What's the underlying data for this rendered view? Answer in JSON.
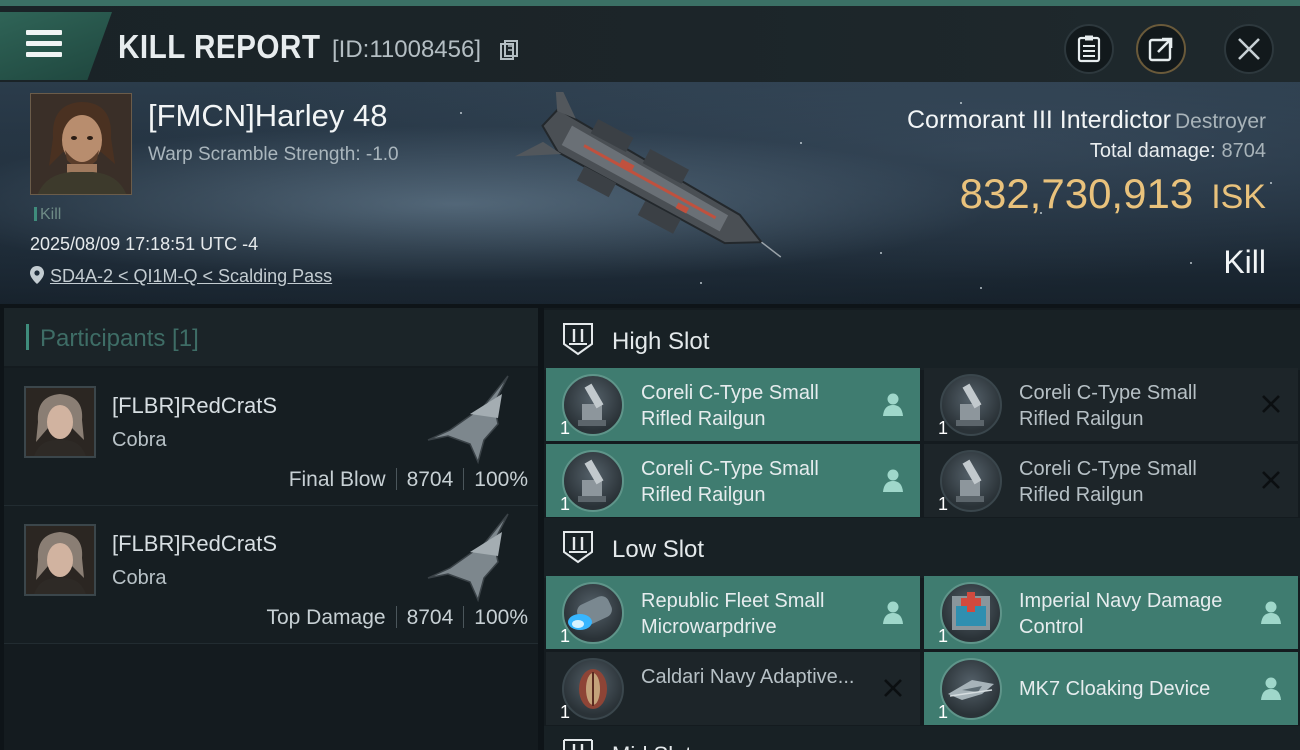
{
  "header": {
    "title": "KILL REPORT",
    "report_id": "[ID:11008456]",
    "menu_icon": "hamburger-menu-icon",
    "actions": [
      "clipboard-icon",
      "share-icon",
      "close-icon"
    ]
  },
  "victim": {
    "name": "[FMCN]Harley 48",
    "warp_scramble": "Warp Scramble Strength: -1.0",
    "kill_tag": "Kill",
    "datetime": "2025/08/09 17:18:51 UTC -4",
    "location": "SD4A-2 < QI1M-Q < Scalding Pass"
  },
  "ship": {
    "name": "Cormorant III Interdictor",
    "class": "Destroyer",
    "total_damage_label": "Total damage:",
    "total_damage": "8704",
    "isk_value": "832,730,913",
    "isk_unit": "ISK",
    "result": "Kill"
  },
  "participants": {
    "header": "Participants [1]",
    "rows": [
      {
        "name": "[FLBR]RedCratS",
        "ship": "Cobra",
        "role": "Final Blow",
        "damage": "8704",
        "percent": "100%"
      },
      {
        "name": "[FLBR]RedCratS",
        "ship": "Cobra",
        "role": "Top Damage",
        "damage": "8704",
        "percent": "100%"
      }
    ]
  },
  "slots": {
    "high": {
      "label": "High Slot",
      "modules": [
        {
          "name": "Coreli C-Type Small Rifled Railgun",
          "qty": "1",
          "state": "dropped"
        },
        {
          "name": "Coreli C-Type Small Rifled Railgun",
          "qty": "1",
          "state": "destroyed"
        },
        {
          "name": "Coreli C-Type Small Rifled Railgun",
          "qty": "1",
          "state": "dropped"
        },
        {
          "name": "Coreli C-Type Small Rifled Railgun",
          "qty": "1",
          "state": "destroyed"
        }
      ]
    },
    "low": {
      "label": "Low Slot",
      "modules": [
        {
          "name": "Republic Fleet Small Microwarpdrive",
          "qty": "1",
          "state": "dropped"
        },
        {
          "name": "Imperial Navy Damage Control",
          "qty": "1",
          "state": "dropped"
        },
        {
          "name": "Caldari Navy Adaptive...",
          "qty": "1",
          "state": "destroyed"
        },
        {
          "name": "MK7 Cloaking Device",
          "qty": "1",
          "state": "dropped"
        }
      ]
    },
    "mid": {
      "label": "Mid Slot"
    }
  },
  "colors": {
    "accent_teal": "#3f7c70",
    "isk_gold": "#e9c27c",
    "background": "#141b1f"
  }
}
